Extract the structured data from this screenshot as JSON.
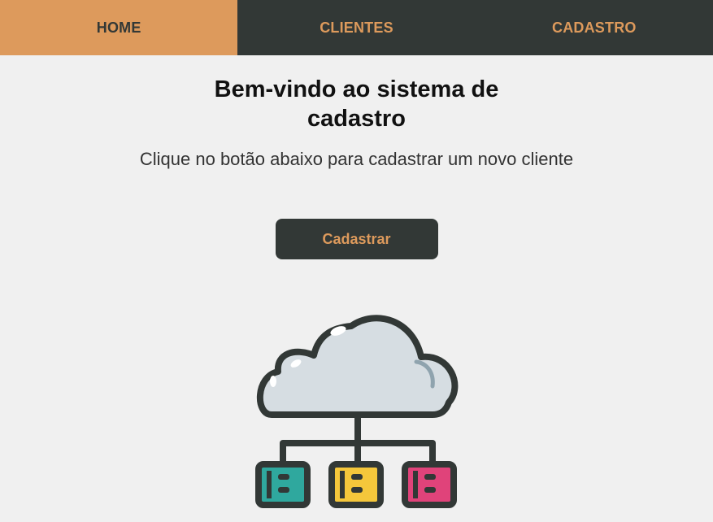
{
  "nav": {
    "items": [
      {
        "label": "HOME",
        "active": true
      },
      {
        "label": "CLIENTES",
        "active": false
      },
      {
        "label": "CADASTRO",
        "active": false
      }
    ]
  },
  "main": {
    "title": "Bem-vindo ao sistema de cadastro",
    "subtitle": "Clique no botão abaixo para cadastrar um novo cliente",
    "button_label": "Cadastrar"
  },
  "colors": {
    "accent": "#dd9a5c",
    "dark": "#323836",
    "background": "#f0f0f0",
    "server_teal": "#2fa89e",
    "server_yellow": "#f5c73b",
    "server_pink": "#e0437a",
    "cloud": "#d6dde2"
  },
  "illustration": {
    "icon": "cloud-network-icon"
  }
}
